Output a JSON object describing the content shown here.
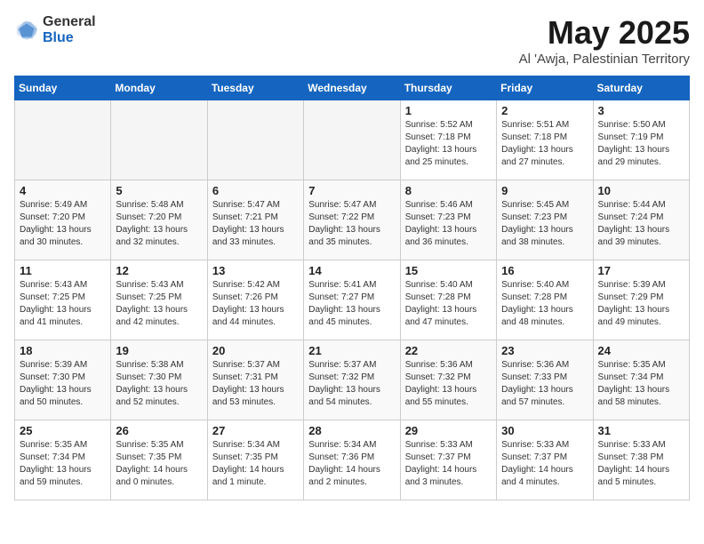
{
  "logo": {
    "general": "General",
    "blue": "Blue"
  },
  "title": {
    "month": "May 2025",
    "location": "Al 'Awja, Palestinian Territory"
  },
  "days": [
    "Sunday",
    "Monday",
    "Tuesday",
    "Wednesday",
    "Thursday",
    "Friday",
    "Saturday"
  ],
  "weeks": [
    [
      {
        "day": "",
        "info": ""
      },
      {
        "day": "",
        "info": ""
      },
      {
        "day": "",
        "info": ""
      },
      {
        "day": "",
        "info": ""
      },
      {
        "day": "1",
        "info": "Sunrise: 5:52 AM\nSunset: 7:18 PM\nDaylight: 13 hours\nand 25 minutes."
      },
      {
        "day": "2",
        "info": "Sunrise: 5:51 AM\nSunset: 7:18 PM\nDaylight: 13 hours\nand 27 minutes."
      },
      {
        "day": "3",
        "info": "Sunrise: 5:50 AM\nSunset: 7:19 PM\nDaylight: 13 hours\nand 29 minutes."
      }
    ],
    [
      {
        "day": "4",
        "info": "Sunrise: 5:49 AM\nSunset: 7:20 PM\nDaylight: 13 hours\nand 30 minutes."
      },
      {
        "day": "5",
        "info": "Sunrise: 5:48 AM\nSunset: 7:20 PM\nDaylight: 13 hours\nand 32 minutes."
      },
      {
        "day": "6",
        "info": "Sunrise: 5:47 AM\nSunset: 7:21 PM\nDaylight: 13 hours\nand 33 minutes."
      },
      {
        "day": "7",
        "info": "Sunrise: 5:47 AM\nSunset: 7:22 PM\nDaylight: 13 hours\nand 35 minutes."
      },
      {
        "day": "8",
        "info": "Sunrise: 5:46 AM\nSunset: 7:23 PM\nDaylight: 13 hours\nand 36 minutes."
      },
      {
        "day": "9",
        "info": "Sunrise: 5:45 AM\nSunset: 7:23 PM\nDaylight: 13 hours\nand 38 minutes."
      },
      {
        "day": "10",
        "info": "Sunrise: 5:44 AM\nSunset: 7:24 PM\nDaylight: 13 hours\nand 39 minutes."
      }
    ],
    [
      {
        "day": "11",
        "info": "Sunrise: 5:43 AM\nSunset: 7:25 PM\nDaylight: 13 hours\nand 41 minutes."
      },
      {
        "day": "12",
        "info": "Sunrise: 5:43 AM\nSunset: 7:25 PM\nDaylight: 13 hours\nand 42 minutes."
      },
      {
        "day": "13",
        "info": "Sunrise: 5:42 AM\nSunset: 7:26 PM\nDaylight: 13 hours\nand 44 minutes."
      },
      {
        "day": "14",
        "info": "Sunrise: 5:41 AM\nSunset: 7:27 PM\nDaylight: 13 hours\nand 45 minutes."
      },
      {
        "day": "15",
        "info": "Sunrise: 5:40 AM\nSunset: 7:28 PM\nDaylight: 13 hours\nand 47 minutes."
      },
      {
        "day": "16",
        "info": "Sunrise: 5:40 AM\nSunset: 7:28 PM\nDaylight: 13 hours\nand 48 minutes."
      },
      {
        "day": "17",
        "info": "Sunrise: 5:39 AM\nSunset: 7:29 PM\nDaylight: 13 hours\nand 49 minutes."
      }
    ],
    [
      {
        "day": "18",
        "info": "Sunrise: 5:39 AM\nSunset: 7:30 PM\nDaylight: 13 hours\nand 50 minutes."
      },
      {
        "day": "19",
        "info": "Sunrise: 5:38 AM\nSunset: 7:30 PM\nDaylight: 13 hours\nand 52 minutes."
      },
      {
        "day": "20",
        "info": "Sunrise: 5:37 AM\nSunset: 7:31 PM\nDaylight: 13 hours\nand 53 minutes."
      },
      {
        "day": "21",
        "info": "Sunrise: 5:37 AM\nSunset: 7:32 PM\nDaylight: 13 hours\nand 54 minutes."
      },
      {
        "day": "22",
        "info": "Sunrise: 5:36 AM\nSunset: 7:32 PM\nDaylight: 13 hours\nand 55 minutes."
      },
      {
        "day": "23",
        "info": "Sunrise: 5:36 AM\nSunset: 7:33 PM\nDaylight: 13 hours\nand 57 minutes."
      },
      {
        "day": "24",
        "info": "Sunrise: 5:35 AM\nSunset: 7:34 PM\nDaylight: 13 hours\nand 58 minutes."
      }
    ],
    [
      {
        "day": "25",
        "info": "Sunrise: 5:35 AM\nSunset: 7:34 PM\nDaylight: 13 hours\nand 59 minutes."
      },
      {
        "day": "26",
        "info": "Sunrise: 5:35 AM\nSunset: 7:35 PM\nDaylight: 14 hours\nand 0 minutes."
      },
      {
        "day": "27",
        "info": "Sunrise: 5:34 AM\nSunset: 7:35 PM\nDaylight: 14 hours\nand 1 minute."
      },
      {
        "day": "28",
        "info": "Sunrise: 5:34 AM\nSunset: 7:36 PM\nDaylight: 14 hours\nand 2 minutes."
      },
      {
        "day": "29",
        "info": "Sunrise: 5:33 AM\nSunset: 7:37 PM\nDaylight: 14 hours\nand 3 minutes."
      },
      {
        "day": "30",
        "info": "Sunrise: 5:33 AM\nSunset: 7:37 PM\nDaylight: 14 hours\nand 4 minutes."
      },
      {
        "day": "31",
        "info": "Sunrise: 5:33 AM\nSunset: 7:38 PM\nDaylight: 14 hours\nand 5 minutes."
      }
    ]
  ]
}
